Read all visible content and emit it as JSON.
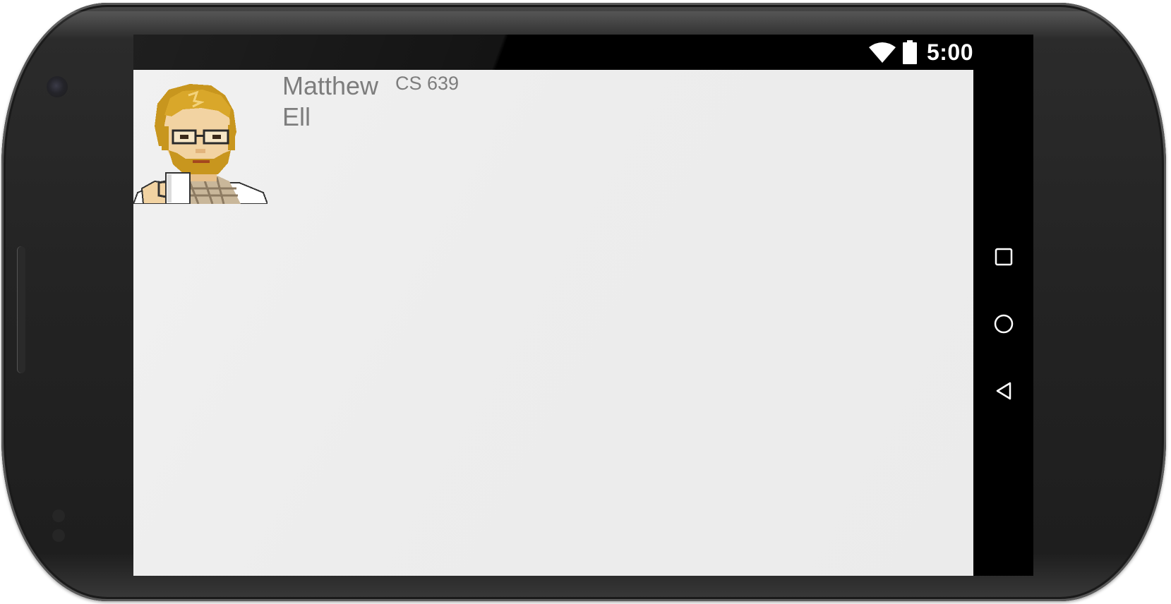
{
  "status_bar": {
    "time": "5:00",
    "icons": [
      "wifi-icon",
      "battery-icon"
    ]
  },
  "profile": {
    "name": "Matthew Ell",
    "course": "CS 639",
    "avatar": "pixel-art-avatar-bearded-man-with-glasses-holding-mug"
  },
  "navigation": {
    "buttons": [
      "recents-square-icon",
      "home-circle-icon",
      "back-triangle-icon"
    ]
  },
  "colors": {
    "app_background": "#EDEDED",
    "text": "#7D7D7D",
    "system_bars": "#000000",
    "device_body": "#232323"
  }
}
